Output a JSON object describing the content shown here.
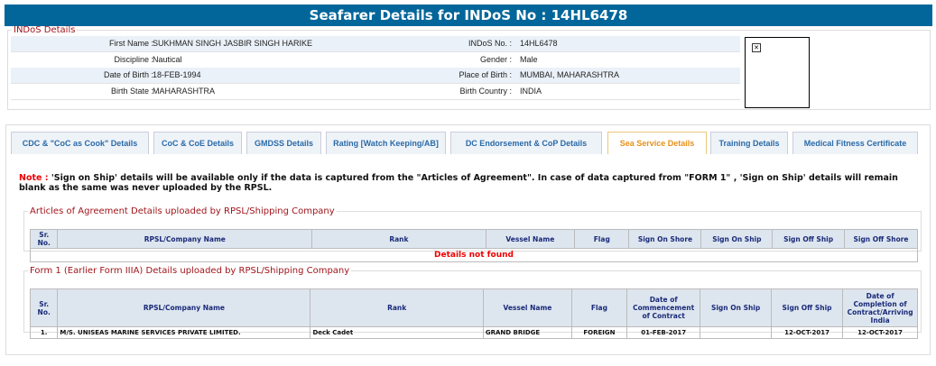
{
  "title": "Seafarer Details for INDoS No : 14HL6478",
  "indos": {
    "legend": "INDoS Details",
    "rows": [
      {
        "l1": "First Name :",
        "v1": "SUKHMAN SINGH JASBIR SINGH HARIKE",
        "l2": "INDoS No. :",
        "v2": "14HL6478"
      },
      {
        "l1": "Discipline :",
        "v1": "Nautical",
        "l2": "Gender :",
        "v2": "Male"
      },
      {
        "l1": "Date of Birth :",
        "v1": "18-FEB-1994",
        "l2": "Place of Birth :",
        "v2": "MUMBAI, MAHARASHTRA"
      },
      {
        "l1": "Birth State :",
        "v1": "MAHARASHTRA",
        "l2": "Birth Country :",
        "v2": "INDIA"
      }
    ]
  },
  "tabs": [
    "CDC & \"CoC as Cook\" Details",
    "CoC & CoE Details",
    "GMDSS Details",
    "Rating [Watch Keeping/AB]",
    "DC Endorsement & CoP Details",
    "Sea Service Details",
    "Training Details",
    "Medical Fitness Certificate"
  ],
  "note": {
    "label": "Note :",
    "text": " 'Sign on Ship' details will be available only if the data is captured from the \"Articles of Agreement\". In case of data captured from \"FORM 1\" , 'Sign on Ship' details will remain blank as the same was never uploaded by the RPSL."
  },
  "articles": {
    "legend": "Articles of Agreement Details uploaded by RPSL/Shipping Company",
    "headers": [
      "Sr. No.",
      "RPSL/Company Name",
      "Rank",
      "Vessel Name",
      "Flag",
      "Sign On Shore",
      "Sign On Ship",
      "Sign Off Ship",
      "Sign Off Shore"
    ],
    "empty": "Details not found"
  },
  "form1": {
    "legend": "Form 1 (Earlier Form IIIA) Details uploaded by RPSL/Shipping Company",
    "headers": [
      "Sr. No.",
      "RPSL/Company Name",
      "Rank",
      "Vessel Name",
      "Flag",
      "Date of Commencement of Contract",
      "Sign On Ship",
      "Sign Off Ship",
      "Date of Completion of Contract/Arriving India"
    ],
    "rows": [
      [
        "1.",
        "M/S. UNISEAS MARINE SERVICES PRIVATE LIMITED.",
        "Deck Cadet",
        "GRAND BRIDGE",
        "FOREIGN",
        "01-FEB-2017",
        "",
        "12-OCT-2017",
        "12-OCT-2017"
      ]
    ]
  }
}
